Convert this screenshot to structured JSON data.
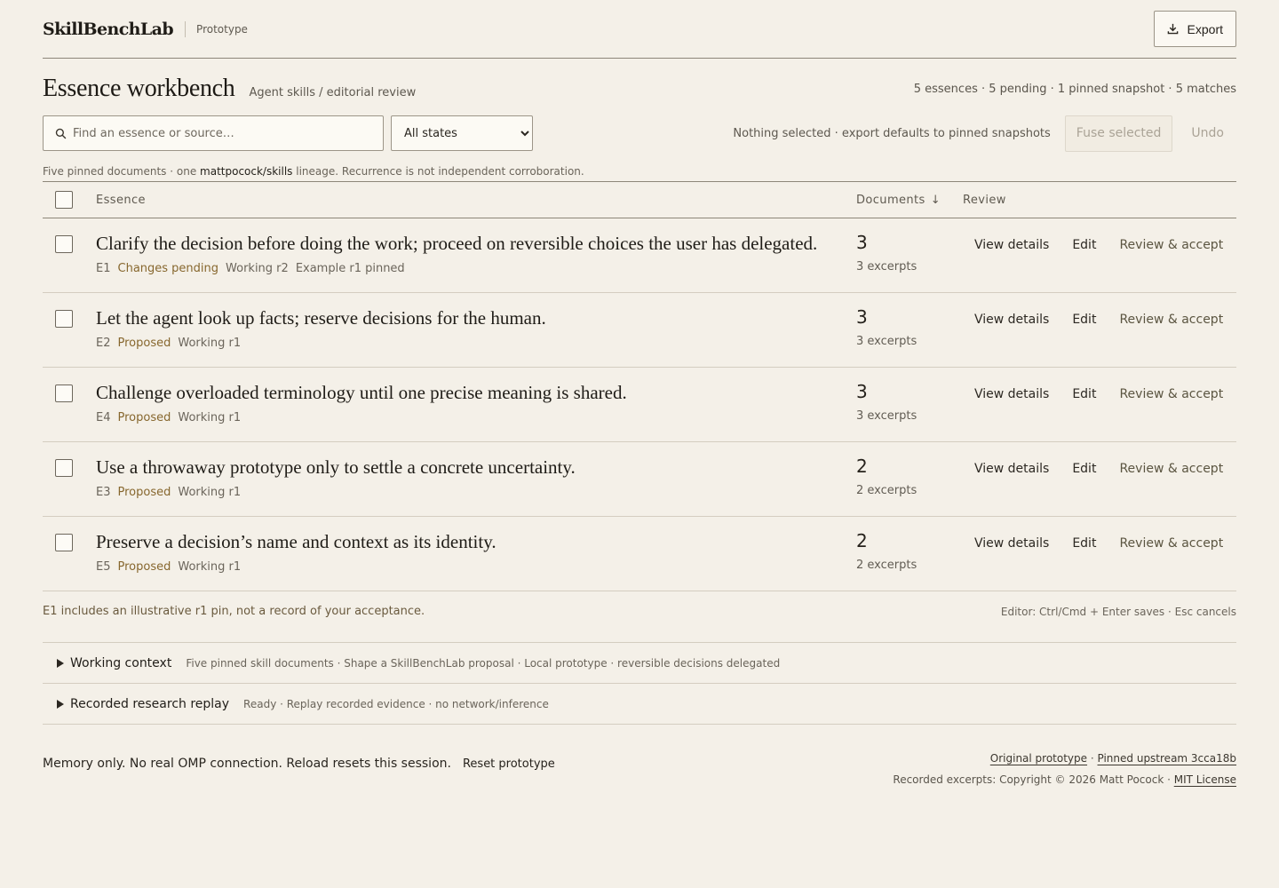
{
  "header": {
    "brand": "SkillBenchLab",
    "tag": "Prototype",
    "export_label": "Export"
  },
  "title_row": {
    "title": "Essence workbench",
    "breadcrumb": "Agent skills / editorial review",
    "summary": "5 essences · 5 pending · 1 pinned snapshot · 5 matches"
  },
  "toolbar": {
    "search_placeholder": "Find an essence or source…",
    "state_filter": "All states",
    "selection_note": "Nothing selected · export defaults to pinned snapshots",
    "fuse_label": "Fuse selected",
    "undo_label": "Undo"
  },
  "lineage": {
    "before": "Five pinned documents · one ",
    "highlight": "mattpocock/skills",
    "after": " lineage. Recurrence is not independent corroboration."
  },
  "table": {
    "headers": {
      "essence": "Essence",
      "documents": "Documents",
      "sort_arrow": "↓",
      "review": "Review"
    },
    "actions": {
      "view": "View details",
      "edit": "Edit",
      "accept": "Review & accept"
    },
    "rows": [
      {
        "text": "Clarify the decision before doing the work; proceed on reversible choices the user has delegated.",
        "id": "E1",
        "state": "Changes pending",
        "working": "Working r2",
        "extra": "Example r1 pinned",
        "count": "3",
        "excerpts": "3 excerpts"
      },
      {
        "text": "Let the agent look up facts; reserve decisions for the human.",
        "id": "E2",
        "state": "Proposed",
        "working": "Working r1",
        "extra": "",
        "count": "3",
        "excerpts": "3 excerpts"
      },
      {
        "text": "Challenge overloaded terminology until one precise meaning is shared.",
        "id": "E4",
        "state": "Proposed",
        "working": "Working r1",
        "extra": "",
        "count": "3",
        "excerpts": "3 excerpts"
      },
      {
        "text": "Use a throwaway prototype only to settle a concrete uncertainty.",
        "id": "E3",
        "state": "Proposed",
        "working": "Working r1",
        "extra": "",
        "count": "2",
        "excerpts": "2 excerpts"
      },
      {
        "text": "Preserve a decision’s name and context as its identity.",
        "id": "E5",
        "state": "Proposed",
        "working": "Working r1",
        "extra": "",
        "count": "2",
        "excerpts": "2 excerpts"
      }
    ],
    "footnote": "E1 includes an illustrative r1 pin, not a record of your acceptance.",
    "shortcut": "Editor: Ctrl/Cmd + Enter saves · Esc cancels"
  },
  "working_context": {
    "title": "Working context",
    "detail": "Five pinned skill documents · Shape a SkillBenchLab proposal · Local prototype · reversible decisions delegated"
  },
  "research_replay": {
    "title": "Recorded research replay",
    "detail": "Ready · Replay recorded evidence · no network/inference"
  },
  "footer": {
    "memory_note": "Memory only. No real OMP connection. Reload resets this session.",
    "reset_label": "Reset prototype",
    "original_link": "Original prototype",
    "sep": " · ",
    "upstream_link": "Pinned upstream 3cca18b",
    "copyright": "Recorded excerpts: Copyright © 2026 Matt Pocock · ",
    "license_link": "MIT License"
  }
}
